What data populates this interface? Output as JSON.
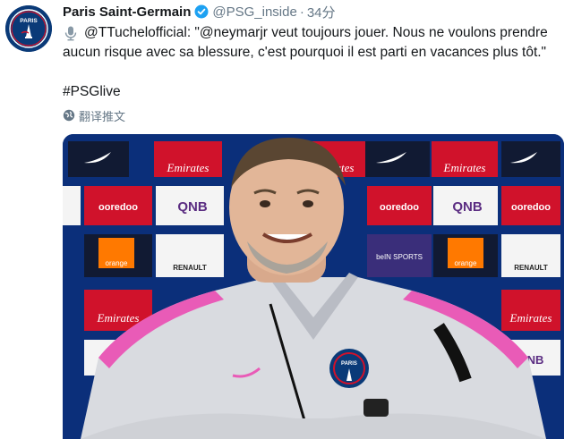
{
  "account": {
    "avatar_label": "PARIS",
    "display_name": "Paris Saint-Germain",
    "handle": "@PSG_inside",
    "separator": "·",
    "time": "34分"
  },
  "tweet": {
    "mention1": "@TTuchelofficial",
    "quote_line1": " : \"@neymarjr veut toujours jouer. Nous ne voulons prendre",
    "line2": "aucun risque avec sa blessure, c'est pourquoi il est parti en vacances plus tôt.\"",
    "hashtag": "#PSGlive"
  },
  "translate": {
    "label": "翻译推文"
  },
  "media": {
    "sponsors": [
      "Emirates",
      "QNB",
      "ooredoo",
      "RENAULT",
      "orange",
      "beIN SPORTS"
    ],
    "crest_text": "PARIS",
    "colors": {
      "backdrop": "#0b2f7a",
      "red_panel": "#d0122b",
      "white_panel": "#f4f4f4",
      "jacket": "#d9dbe0",
      "jacket_trim": "#e95bb7"
    }
  },
  "colors": {
    "verified_blue": "#1da1f2",
    "muted_text": "#657786",
    "psg_navy": "#0a3a78"
  }
}
